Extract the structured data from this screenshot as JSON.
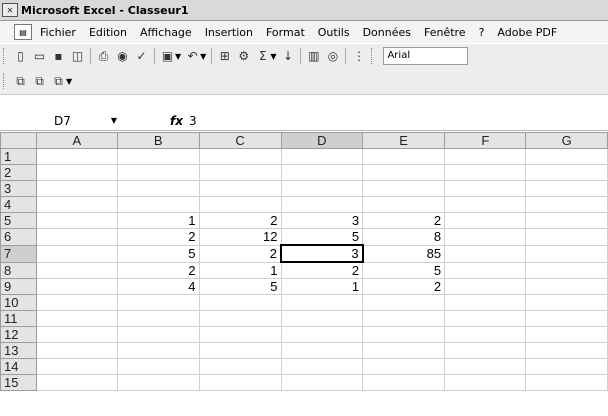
{
  "window": {
    "title": "Microsoft Excel - Classeur1"
  },
  "menu": {
    "items": [
      "Fichier",
      "Edition",
      "Affichage",
      "Insertion",
      "Format",
      "Outils",
      "Données",
      "Fenêtre",
      "?",
      "Adobe PDF"
    ]
  },
  "toolbar": {
    "font_name": "Arial"
  },
  "formula_bar": {
    "cell_ref": "D7",
    "fx_label": "fx",
    "value": "3"
  },
  "grid": {
    "columns": [
      "A",
      "B",
      "C",
      "D",
      "E",
      "F",
      "G"
    ],
    "rows": [
      {
        "label": "1",
        "cells": [
          "",
          "",
          "",
          "",
          "",
          "",
          ""
        ]
      },
      {
        "label": "2",
        "cells": [
          "",
          "",
          "",
          "",
          "",
          "",
          ""
        ]
      },
      {
        "label": "3",
        "cells": [
          "",
          "",
          "",
          "",
          "",
          "",
          ""
        ]
      },
      {
        "label": "4",
        "cells": [
          "",
          "",
          "",
          "",
          "",
          "",
          ""
        ]
      },
      {
        "label": "5",
        "cells": [
          "",
          "1",
          "2",
          "3",
          "2",
          "",
          ""
        ]
      },
      {
        "label": "6",
        "cells": [
          "",
          "2",
          "12",
          "5",
          "8",
          "",
          ""
        ]
      },
      {
        "label": "7",
        "cells": [
          "",
          "5",
          "2",
          "3",
          "85",
          "",
          ""
        ]
      },
      {
        "label": "8",
        "cells": [
          "",
          "2",
          "1",
          "2",
          "5",
          "",
          ""
        ]
      },
      {
        "label": "9",
        "cells": [
          "",
          "4",
          "5",
          "1",
          "2",
          "",
          ""
        ]
      },
      {
        "label": "10",
        "cells": [
          "",
          "",
          "",
          "",
          "",
          "",
          ""
        ]
      },
      {
        "label": "11",
        "cells": [
          "",
          "",
          "",
          "",
          "",
          "",
          ""
        ]
      },
      {
        "label": "12",
        "cells": [
          "",
          "",
          "",
          "",
          "",
          "",
          ""
        ]
      },
      {
        "label": "13",
        "cells": [
          "",
          "",
          "",
          "",
          "",
          "",
          ""
        ]
      },
      {
        "label": "14",
        "cells": [
          "",
          "",
          "",
          "",
          "",
          "",
          ""
        ]
      },
      {
        "label": "15",
        "cells": [
          "",
          "",
          "",
          "",
          "",
          "",
          ""
        ]
      }
    ],
    "active_cell": "D7"
  }
}
